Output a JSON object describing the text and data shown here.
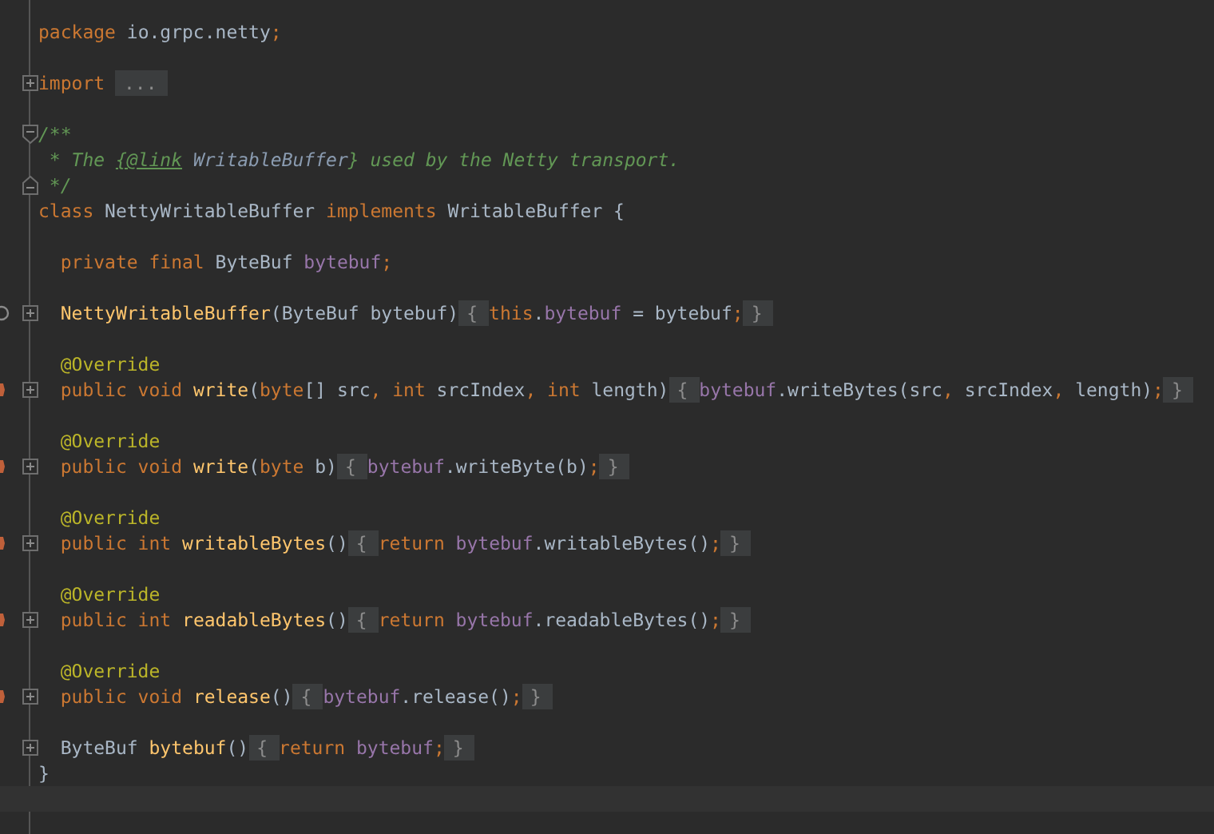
{
  "editor": {
    "lines": [
      {
        "kind": "code",
        "tokens": [
          {
            "kind": "kw",
            "text": "package "
          },
          {
            "kind": "plain",
            "text": "io.grpc.netty"
          },
          {
            "kind": "kw",
            "text": ";"
          }
        ]
      },
      {
        "kind": "blank"
      },
      {
        "kind": "code",
        "fold": {
          "kind": "collapsed"
        },
        "tokens": [
          {
            "kind": "kw",
            "text": "import "
          },
          {
            "kind": "fold",
            "text": "..."
          }
        ]
      },
      {
        "kind": "blank"
      },
      {
        "kind": "code",
        "fold": {
          "kind": "start"
        },
        "tokens": [
          {
            "kind": "doc",
            "text": "/**"
          }
        ]
      },
      {
        "kind": "code",
        "tokens": [
          {
            "kind": "doc",
            "text": " * The "
          },
          {
            "kind": "doctag",
            "text": "{@link"
          },
          {
            "kind": "docref",
            "text": " WritableBuffer"
          },
          {
            "kind": "doc",
            "text": "} used by the Netty transport."
          }
        ]
      },
      {
        "kind": "code",
        "fold": {
          "kind": "end"
        },
        "tokens": [
          {
            "kind": "doc",
            "text": " */"
          }
        ]
      },
      {
        "kind": "code",
        "tokens": [
          {
            "kind": "kw",
            "text": "class "
          },
          {
            "kind": "plain",
            "text": "NettyWritableBuffer "
          },
          {
            "kind": "kw",
            "text": "implements "
          },
          {
            "kind": "plain",
            "text": "WritableBuffer {"
          }
        ]
      },
      {
        "kind": "blank"
      },
      {
        "kind": "code",
        "tokens": [
          {
            "kind": "kw",
            "text": "  private final "
          },
          {
            "kind": "plain",
            "text": "ByteBuf "
          },
          {
            "kind": "field",
            "text": "bytebuf"
          },
          {
            "kind": "kw",
            "text": ";"
          }
        ]
      },
      {
        "kind": "blank"
      },
      {
        "kind": "code",
        "fold": {
          "kind": "collapsed"
        },
        "marker": {
          "kind": "implements"
        },
        "tokens": [
          {
            "kind": "decl",
            "text": "  NettyWritableBuffer"
          },
          {
            "kind": "plain",
            "text": "(ByteBuf bytebuf)"
          },
          {
            "kind": "fold",
            "text": "{"
          },
          {
            "kind": "kw",
            "text": "this"
          },
          {
            "kind": "plain",
            "text": "."
          },
          {
            "kind": "field",
            "text": "bytebuf"
          },
          {
            "kind": "plain",
            "text": " = bytebuf"
          },
          {
            "kind": "kw",
            "text": ";"
          },
          {
            "kind": "fold",
            "text": "}"
          }
        ]
      },
      {
        "kind": "blank"
      },
      {
        "kind": "code",
        "tokens": [
          {
            "kind": "annot",
            "text": "  @Override"
          }
        ]
      },
      {
        "kind": "code",
        "fold": {
          "kind": "collapsed"
        },
        "marker": {
          "kind": "override"
        },
        "tokens": [
          {
            "kind": "kw",
            "text": "  public void "
          },
          {
            "kind": "decl",
            "text": "write"
          },
          {
            "kind": "plain",
            "text": "("
          },
          {
            "kind": "kw",
            "text": "byte"
          },
          {
            "kind": "plain",
            "text": "[] src"
          },
          {
            "kind": "kw",
            "text": ", int "
          },
          {
            "kind": "plain",
            "text": "srcIndex"
          },
          {
            "kind": "kw",
            "text": ", int "
          },
          {
            "kind": "plain",
            "text": "length)"
          },
          {
            "kind": "fold",
            "text": "{"
          },
          {
            "kind": "field",
            "text": "bytebuf"
          },
          {
            "kind": "plain",
            "text": ".writeBytes(src"
          },
          {
            "kind": "kw",
            "text": ", "
          },
          {
            "kind": "plain",
            "text": "srcIndex"
          },
          {
            "kind": "kw",
            "text": ", "
          },
          {
            "kind": "plain",
            "text": "length)"
          },
          {
            "kind": "kw",
            "text": ";"
          },
          {
            "kind": "fold",
            "text": "}"
          }
        ]
      },
      {
        "kind": "blank"
      },
      {
        "kind": "code",
        "tokens": [
          {
            "kind": "annot",
            "text": "  @Override"
          }
        ]
      },
      {
        "kind": "code",
        "fold": {
          "kind": "collapsed"
        },
        "marker": {
          "kind": "override"
        },
        "tokens": [
          {
            "kind": "kw",
            "text": "  public void "
          },
          {
            "kind": "decl",
            "text": "write"
          },
          {
            "kind": "plain",
            "text": "("
          },
          {
            "kind": "kw",
            "text": "byte "
          },
          {
            "kind": "plain",
            "text": "b)"
          },
          {
            "kind": "fold",
            "text": "{"
          },
          {
            "kind": "field",
            "text": "bytebuf"
          },
          {
            "kind": "plain",
            "text": ".writeByte(b)"
          },
          {
            "kind": "kw",
            "text": ";"
          },
          {
            "kind": "fold",
            "text": "}"
          }
        ]
      },
      {
        "kind": "blank"
      },
      {
        "kind": "code",
        "tokens": [
          {
            "kind": "annot",
            "text": "  @Override"
          }
        ]
      },
      {
        "kind": "code",
        "fold": {
          "kind": "collapsed"
        },
        "marker": {
          "kind": "override"
        },
        "tokens": [
          {
            "kind": "kw",
            "text": "  public int "
          },
          {
            "kind": "decl",
            "text": "writableBytes"
          },
          {
            "kind": "plain",
            "text": "()"
          },
          {
            "kind": "fold",
            "text": "{"
          },
          {
            "kind": "kw",
            "text": "return "
          },
          {
            "kind": "field",
            "text": "bytebuf"
          },
          {
            "kind": "plain",
            "text": ".writableBytes()"
          },
          {
            "kind": "kw",
            "text": ";"
          },
          {
            "kind": "fold",
            "text": "}"
          }
        ]
      },
      {
        "kind": "blank"
      },
      {
        "kind": "code",
        "tokens": [
          {
            "kind": "annot",
            "text": "  @Override"
          }
        ]
      },
      {
        "kind": "code",
        "fold": {
          "kind": "collapsed"
        },
        "marker": {
          "kind": "override"
        },
        "tokens": [
          {
            "kind": "kw",
            "text": "  public int "
          },
          {
            "kind": "decl",
            "text": "readableBytes"
          },
          {
            "kind": "plain",
            "text": "()"
          },
          {
            "kind": "fold",
            "text": "{"
          },
          {
            "kind": "kw",
            "text": "return "
          },
          {
            "kind": "field",
            "text": "bytebuf"
          },
          {
            "kind": "plain",
            "text": ".readableBytes()"
          },
          {
            "kind": "kw",
            "text": ";"
          },
          {
            "kind": "fold",
            "text": "}"
          }
        ]
      },
      {
        "kind": "blank"
      },
      {
        "kind": "code",
        "tokens": [
          {
            "kind": "annot",
            "text": "  @Override"
          }
        ]
      },
      {
        "kind": "code",
        "fold": {
          "kind": "collapsed"
        },
        "marker": {
          "kind": "override"
        },
        "tokens": [
          {
            "kind": "kw",
            "text": "  public void "
          },
          {
            "kind": "decl",
            "text": "release"
          },
          {
            "kind": "plain",
            "text": "()"
          },
          {
            "kind": "fold",
            "text": "{"
          },
          {
            "kind": "field",
            "text": "bytebuf"
          },
          {
            "kind": "plain",
            "text": ".release()"
          },
          {
            "kind": "kw",
            "text": ";"
          },
          {
            "kind": "fold",
            "text": "}"
          }
        ]
      },
      {
        "kind": "blank"
      },
      {
        "kind": "code",
        "fold": {
          "kind": "collapsed"
        },
        "tokens": [
          {
            "kind": "plain",
            "text": "  ByteBuf "
          },
          {
            "kind": "decl",
            "text": "bytebuf"
          },
          {
            "kind": "plain",
            "text": "()"
          },
          {
            "kind": "fold",
            "text": "{"
          },
          {
            "kind": "kw",
            "text": "return "
          },
          {
            "kind": "field",
            "text": "bytebuf"
          },
          {
            "kind": "kw",
            "text": ";"
          },
          {
            "kind": "fold",
            "text": "}"
          }
        ]
      },
      {
        "kind": "code",
        "tokens": [
          {
            "kind": "plain",
            "text": "}"
          }
        ]
      },
      {
        "kind": "current_line"
      }
    ]
  }
}
